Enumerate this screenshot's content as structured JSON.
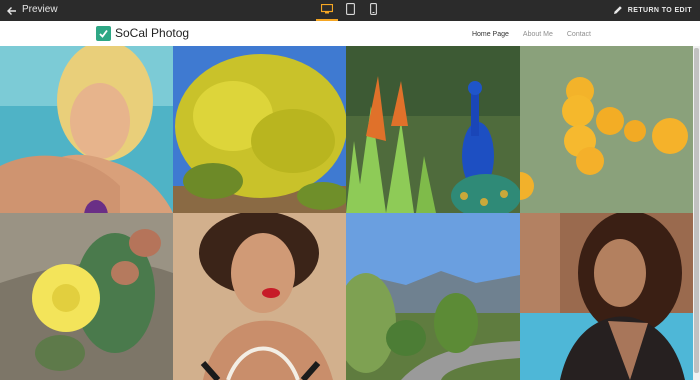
{
  "topbar": {
    "preview_label": "Preview",
    "return_label": "RETURN TO EDIT",
    "devices": [
      "desktop",
      "tablet",
      "mobile"
    ],
    "active_device": "desktop",
    "accent_color": "#f5a623"
  },
  "site": {
    "brand": "SoCal Photog",
    "brand_color": "#2ea785",
    "nav": [
      {
        "label": "Home Page"
      },
      {
        "label": "About Me"
      },
      {
        "label": "Contact"
      }
    ]
  },
  "gallery": {
    "photos": [
      {
        "subject": "blonde-woman-pool"
      },
      {
        "subject": "yellow-flowering-tree"
      },
      {
        "subject": "peacock"
      },
      {
        "subject": "california-poppies"
      },
      {
        "subject": "cactus-flower"
      },
      {
        "subject": "woman-pearls-red-lips"
      },
      {
        "subject": "mountain-road"
      },
      {
        "subject": "woman-leather-vest"
      }
    ]
  }
}
